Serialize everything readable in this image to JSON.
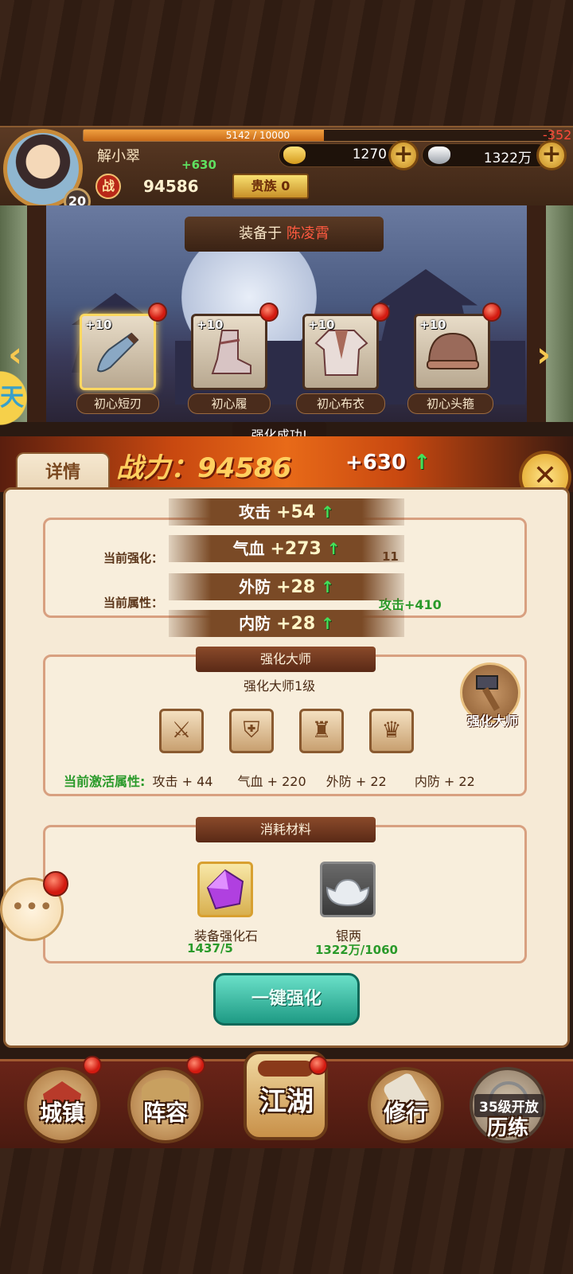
{
  "player": {
    "name": "解小翠",
    "level": "20",
    "exp_text": "5142 / 10000",
    "exp_fraction": 0.5142,
    "power_label": "战",
    "power": "94586",
    "power_gain": "+630",
    "noble_label": "贵族 0",
    "loss_text": "-352"
  },
  "currency": {
    "gold": "1270",
    "silver": "1322万"
  },
  "equip_banner": {
    "prefix": "装备于",
    "owner": "陈凌霄"
  },
  "slots": [
    {
      "level": "+10",
      "name": "初心短刃",
      "icon": "sword-icon"
    },
    {
      "level": "+10",
      "name": "初心履",
      "icon": "boot-icon"
    },
    {
      "level": "+10",
      "name": "初心布衣",
      "icon": "armor-icon"
    },
    {
      "level": "+10",
      "name": "初心头箍",
      "icon": "helmet-icon"
    }
  ],
  "toast": "强化成功!",
  "detail_tab": "详情",
  "power_strip": {
    "label": "战力：",
    "value": "94586",
    "gain": "+630"
  },
  "floating_gains": [
    {
      "stat": "攻击",
      "value": "+54"
    },
    {
      "stat": "气血",
      "value": "+273"
    },
    {
      "stat": "外防",
      "value": "+28"
    },
    {
      "stat": "内防",
      "value": "+28"
    }
  ],
  "current": {
    "enhance_label": "当前强化：",
    "enhance_suffix": "11",
    "attr_label": "当前属性：",
    "attr_next": "攻击+410"
  },
  "master": {
    "title": "强化大师",
    "level_text": "强化大师1级",
    "badge_label": "强化大师",
    "active_label": "当前激活属性:",
    "attrs": [
      "攻击 + 44",
      "气血 + 220",
      "外防 + 22",
      "内防 + 22"
    ]
  },
  "materials": {
    "title": "消耗材料",
    "items": [
      {
        "name": "装备强化石",
        "count": "1437/5",
        "icon": "enhance-stone-icon"
      },
      {
        "name": "银两",
        "count": "1322万/1060",
        "icon": "silver-ingot-icon"
      }
    ]
  },
  "one_key_button": "一键强化",
  "bottom_nav": [
    {
      "label": "城镇",
      "icon": "town-icon"
    },
    {
      "label": "阵容",
      "icon": "lineup-icon"
    },
    {
      "label": "江湖",
      "icon": "jianghu-scroll-icon"
    },
    {
      "label": "修行",
      "icon": "cultivation-icon"
    },
    {
      "label": "历练",
      "icon": "training-icon",
      "locked_text": "35级开放"
    }
  ],
  "colors": {
    "accent_gold": "#f6c850",
    "gain_green": "#44e05a",
    "attr_green": "#2a9a2a",
    "alert_red": "#d21a10",
    "owner_red": "#ff5a40",
    "button_teal": "#1e9a84"
  }
}
